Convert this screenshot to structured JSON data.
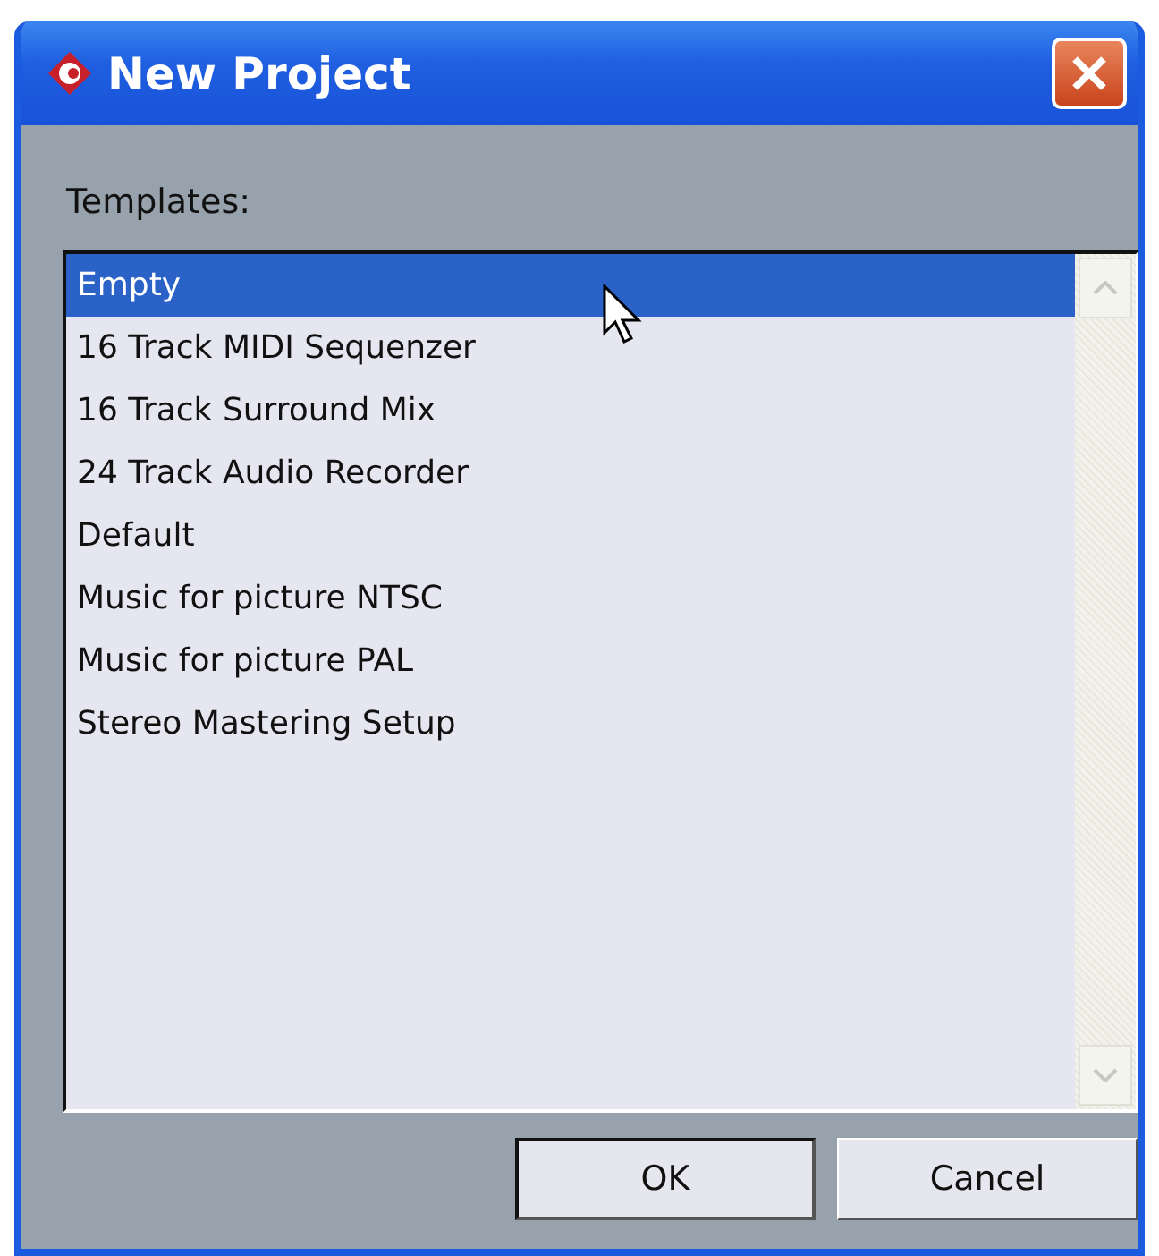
{
  "window": {
    "title": "New Project"
  },
  "templates_label": "Templates:",
  "templates": [
    {
      "label": "Empty",
      "selected": true
    },
    {
      "label": "16 Track MIDI Sequenzer",
      "selected": false
    },
    {
      "label": "16 Track Surround Mix",
      "selected": false
    },
    {
      "label": "24 Track Audio Recorder",
      "selected": false
    },
    {
      "label": "Default",
      "selected": false
    },
    {
      "label": "Music for picture NTSC",
      "selected": false
    },
    {
      "label": "Music for picture PAL",
      "selected": false
    },
    {
      "label": "Stereo Mastering Setup",
      "selected": false
    }
  ],
  "buttons": [
    {
      "label": "OK",
      "default": true
    },
    {
      "label": "Cancel",
      "default": false
    }
  ]
}
